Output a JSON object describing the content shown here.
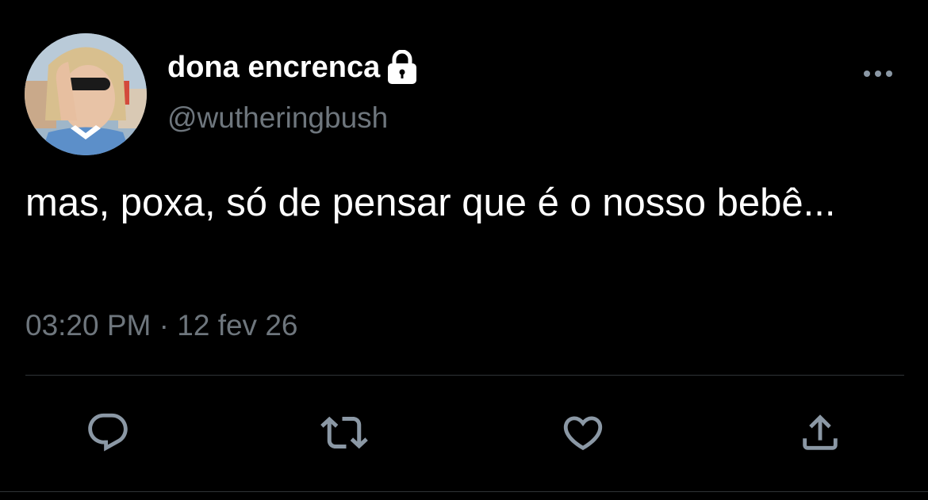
{
  "author": {
    "display_name": "dona encrenca",
    "handle": "@wutheringbush",
    "protected_icon": "lock-icon",
    "avatar": "profile-photo"
  },
  "tweet": {
    "text": "mas, poxa, só de pensar que é o nosso bebê...",
    "time": "03:20 PM",
    "separator": "·",
    "date": "12 fev 26"
  },
  "actions": [
    {
      "name": "reply",
      "icon": "reply-icon"
    },
    {
      "name": "retweet",
      "icon": "retweet-icon"
    },
    {
      "name": "like",
      "icon": "heart-icon"
    },
    {
      "name": "share",
      "icon": "share-icon"
    }
  ],
  "colors": {
    "background": "#000000",
    "primary_text": "#ffffff",
    "secondary_text": "#6e767d",
    "icon": "#8b98a5",
    "divider": "#2f3336"
  }
}
